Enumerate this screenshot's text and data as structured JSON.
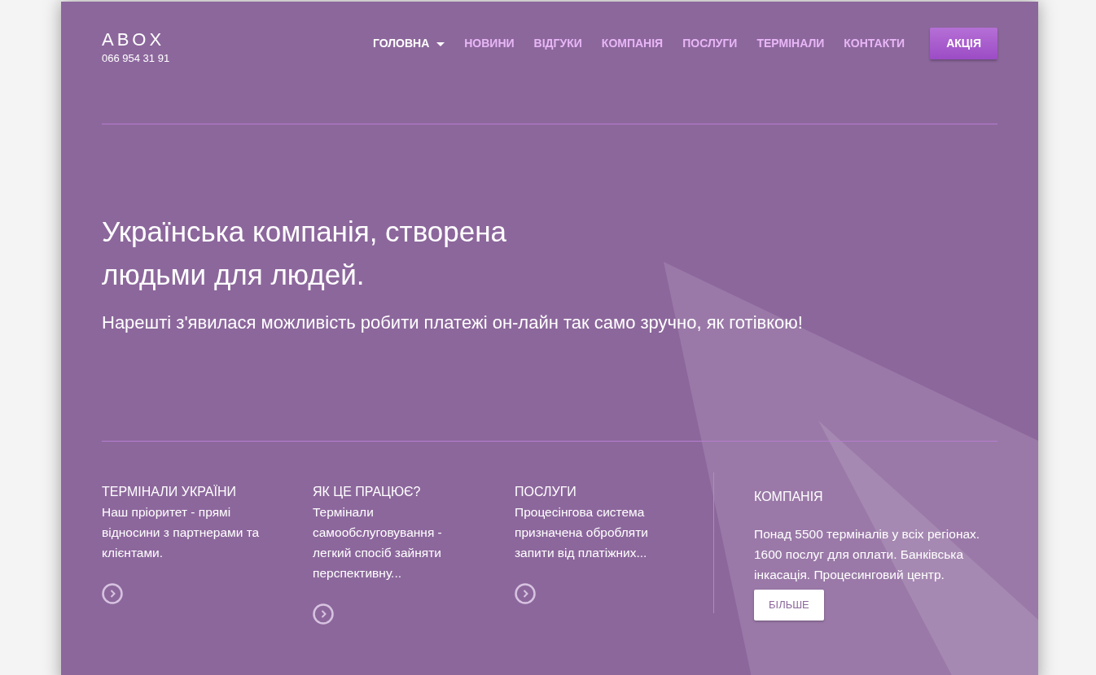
{
  "header": {
    "logo": "ABOX",
    "phone": "066 954 31 91"
  },
  "nav": [
    {
      "label": "ГОЛОВНА",
      "selected": true,
      "dropdown": true
    },
    {
      "label": "НОВИНИ",
      "selected": false,
      "dropdown": false
    },
    {
      "label": "ВІДГУКИ",
      "selected": false,
      "dropdown": false
    },
    {
      "label": "КОМПАНІЯ",
      "selected": false,
      "dropdown": false
    },
    {
      "label": "ПОСЛУГИ",
      "selected": false,
      "dropdown": false
    },
    {
      "label": "ТЕРМІНАЛИ",
      "selected": false,
      "dropdown": false
    },
    {
      "label": "КОНТАКТИ",
      "selected": false,
      "dropdown": false
    }
  ],
  "promo_button": "АКЦІЯ",
  "hero": {
    "title_lines": [
      "Українська компанія, створена",
      "людьми для людей."
    ],
    "subtitle": "Нарешті з'явилася можливість робити платежі он-лайн так само зручно, як готівкою!"
  },
  "features": [
    {
      "title": "ТЕРМІНАЛИ УКРАЇНИ",
      "text": "Наш пріоритет - прямі відносини з партнерами та клієнтами."
    },
    {
      "title": "ЯК ЦЕ ПРАЦЮЄ?",
      "text": "Термінали самообслуговування - легкий спосіб зайняти перспективну..."
    },
    {
      "title": "ПОСЛУГИ",
      "text": "Процесінгова система призначена обробляти запити від платіжних..."
    }
  ],
  "company": {
    "title": "КОМПАНІЯ",
    "text": "Понад 5500 терміналів у всіх регіонах. 1600 послуг для оплати. Банківська інкасація. Процесинговий центр.",
    "button": "БІЛЬШЕ"
  }
}
